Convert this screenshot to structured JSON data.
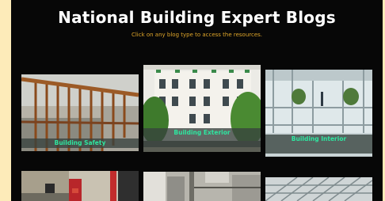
{
  "page": {
    "title": "National Building Expert Blogs",
    "subtitle": "Click on any blog type to access the resources."
  },
  "cards": [
    {
      "label": "Building Safety"
    },
    {
      "label": "Building Exterior"
    },
    {
      "label": "Building Interior"
    }
  ],
  "colors": {
    "page_background": "#fdebb9",
    "panel_background": "#070707",
    "title": "#ffffff",
    "subtitle": "#e0a62a",
    "card_label_text": "#2ee6a0",
    "card_label_background": "#37413e"
  }
}
